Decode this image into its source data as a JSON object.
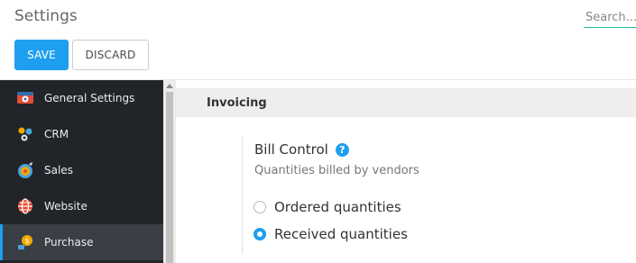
{
  "header": {
    "title": "Settings",
    "search_placeholder": "Search..."
  },
  "toolbar": {
    "save_label": "SAVE",
    "discard_label": "DISCARD"
  },
  "sidebar": {
    "items": [
      {
        "label": "General Settings",
        "icon": "settings-icon"
      },
      {
        "label": "CRM",
        "icon": "crm-icon"
      },
      {
        "label": "Sales",
        "icon": "sales-icon"
      },
      {
        "label": "Website",
        "icon": "website-icon"
      },
      {
        "label": "Purchase",
        "icon": "purchase-icon",
        "active": true
      }
    ]
  },
  "main": {
    "section_title": "Invoicing",
    "setting": {
      "title": "Bill Control",
      "description": "Quantities billed by vendors",
      "help": "?",
      "options": [
        {
          "label": "Ordered quantities",
          "checked": false
        },
        {
          "label": "Received quantities",
          "checked": true
        }
      ]
    }
  },
  "colors": {
    "accent": "#1f9ff0",
    "sidebar_bg": "#212529"
  }
}
